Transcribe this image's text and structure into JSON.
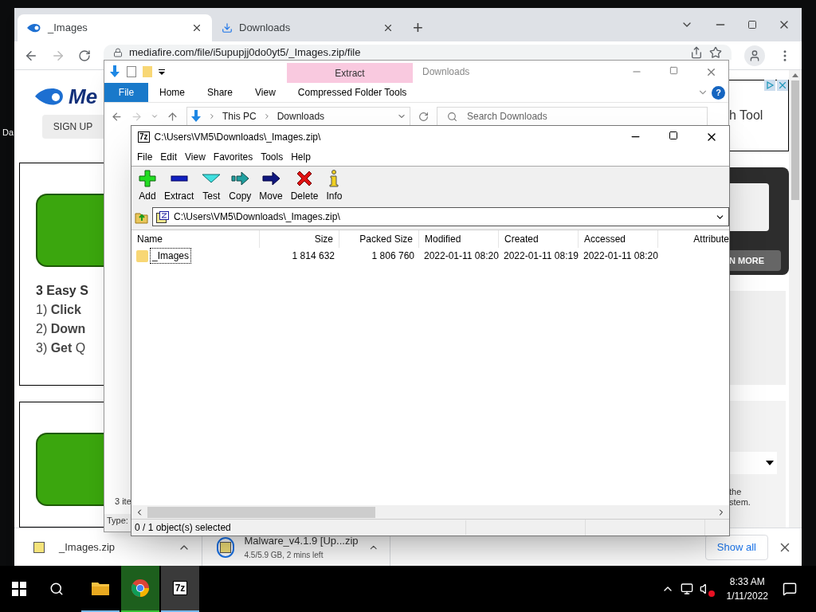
{
  "desktop": {
    "icon_label": "Da"
  },
  "browser": {
    "tabs": [
      {
        "title": "_Images",
        "selected": true,
        "kind": "site"
      },
      {
        "title": "Downloads",
        "selected": false,
        "kind": "download"
      }
    ],
    "new_tab": "+",
    "url": "mediafire.com/file/i5upupjj0do0yt5/_Images.zip/file",
    "page": {
      "logo": "Me",
      "sign_up": "SIGN UP",
      "steps_title": "3 Easy S",
      "steps": [
        "1) **Click**",
        "2) **Down**",
        "3) **Get** Q"
      ],
      "ad_text": "h Tool",
      "learn_more": "N MORE",
      "side_text": "the\nstem."
    },
    "downloads": [
      {
        "name": "_Images.zip",
        "in_progress": false
      },
      {
        "name": "Malware_v4.1.9 [Up...zip",
        "status": "4.5/5.9 GB, 2 mins left",
        "in_progress": true
      }
    ],
    "show_all": "Show all"
  },
  "explorer": {
    "title": "Downloads",
    "context_tab": "Extract",
    "ribbon_tabs": [
      {
        "label": "File",
        "kind": "file"
      },
      {
        "label": "Home",
        "kind": "tab"
      },
      {
        "label": "Share",
        "kind": "tab"
      },
      {
        "label": "View",
        "kind": "tab"
      },
      {
        "label": "Compressed Folder Tools",
        "kind": "context"
      }
    ],
    "help": "?",
    "breadcrumb": [
      "This PC",
      "Downloads"
    ],
    "search_placeholder": "Search Downloads",
    "item_count": "3 ite",
    "details": "Type:"
  },
  "archive": {
    "logo": "7z",
    "title": "C:\\Users\\VM5\\Downloads\\_Images.zip\\",
    "menu": [
      "File",
      "Edit",
      "View",
      "Favorites",
      "Tools",
      "Help"
    ],
    "toolbar": [
      {
        "label": "Add",
        "kind": "add"
      },
      {
        "label": "Extract",
        "kind": "extract"
      },
      {
        "label": "Test",
        "kind": "test"
      },
      {
        "label": "Copy",
        "kind": "copy"
      },
      {
        "label": "Move",
        "kind": "move"
      },
      {
        "label": "Delete",
        "kind": "delete"
      },
      {
        "label": "Info",
        "kind": "info"
      }
    ],
    "path": "C:\\Users\\VM5\\Downloads\\_Images.zip\\",
    "columns": [
      "Name",
      "Size",
      "Packed Size",
      "Modified",
      "Created",
      "Accessed",
      "Attribute"
    ],
    "rows": [
      {
        "cells": [
          "_Images",
          "1 814 632",
          "1 806 760",
          "2022-01-11 08:20",
          "2022-01-11 08:19",
          "2022-01-11 08:20"
        ],
        "focused": true
      }
    ],
    "status": "0 / 1 object(s) selected"
  },
  "taskbar": {
    "apps": [
      {
        "kind": "explorer",
        "selected": false,
        "highlighted": false
      },
      {
        "kind": "chrome",
        "selected": false,
        "highlighted": true
      },
      {
        "kind": "sevenzip",
        "label": "7z",
        "selected": true,
        "highlighted": false
      }
    ],
    "time": "8:33 AM",
    "date": "1/11/2022"
  }
}
